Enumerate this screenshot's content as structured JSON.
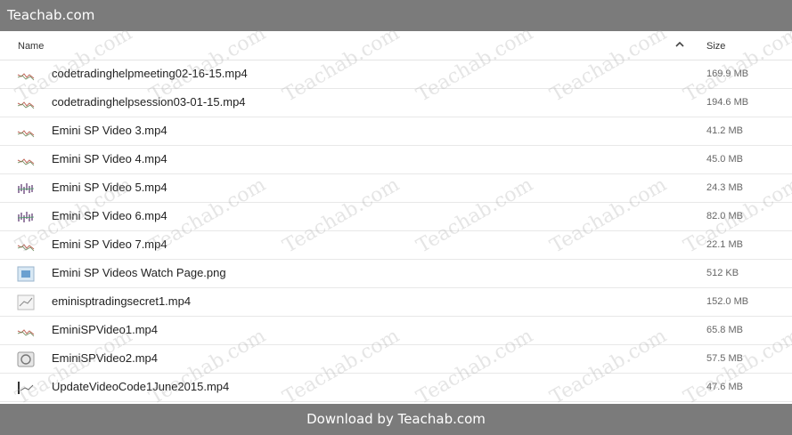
{
  "app": {
    "title": "Teachab.com"
  },
  "columns": {
    "name": "Name",
    "size": "Size",
    "sort_glyph": "^"
  },
  "files": [
    {
      "name": "codetradinghelpmeeting02-16-15.mp4",
      "size": "169.9 MB",
      "icon": "video-thumbnail-icon"
    },
    {
      "name": "codetradinghelpsession03-01-15.mp4",
      "size": "194.6 MB",
      "icon": "video-thumbnail-icon"
    },
    {
      "name": "Emini SP Video 3.mp4",
      "size": "41.2 MB",
      "icon": "video-thumbnail-icon"
    },
    {
      "name": "Emini SP Video 4.mp4",
      "size": "45.0 MB",
      "icon": "video-thumbnail-icon"
    },
    {
      "name": "Emini SP Video 5.mp4",
      "size": "24.3 MB",
      "icon": "video-thumbnail-icon"
    },
    {
      "name": "Emini SP Video 6.mp4",
      "size": "82.0 MB",
      "icon": "video-thumbnail-icon"
    },
    {
      "name": "Emini SP Video 7.mp4",
      "size": "22.1 MB",
      "icon": "video-thumbnail-icon"
    },
    {
      "name": "Emini SP Videos Watch Page.png",
      "size": "512 KB",
      "icon": "image-file-icon"
    },
    {
      "name": "eminisptradingsecret1.mp4",
      "size": "152.0 MB",
      "icon": "video-thumbnail-icon"
    },
    {
      "name": "EminiSPVideo1.mp4",
      "size": "65.8 MB",
      "icon": "video-thumbnail-icon"
    },
    {
      "name": "EminiSPVideo2.mp4",
      "size": "57.5 MB",
      "icon": "video-thumbnail-icon"
    },
    {
      "name": "UpdateVideoCode1June2015.mp4",
      "size": "47.6 MB",
      "icon": "video-thumbnail-icon"
    }
  ],
  "footer": {
    "text": "Download by Teachab.com"
  },
  "watermark": {
    "text": "Teachab.com",
    "color": "#a0a0a0"
  },
  "colors": {
    "bar": "#7b7b7b",
    "row_border": "#e8e8e8"
  }
}
